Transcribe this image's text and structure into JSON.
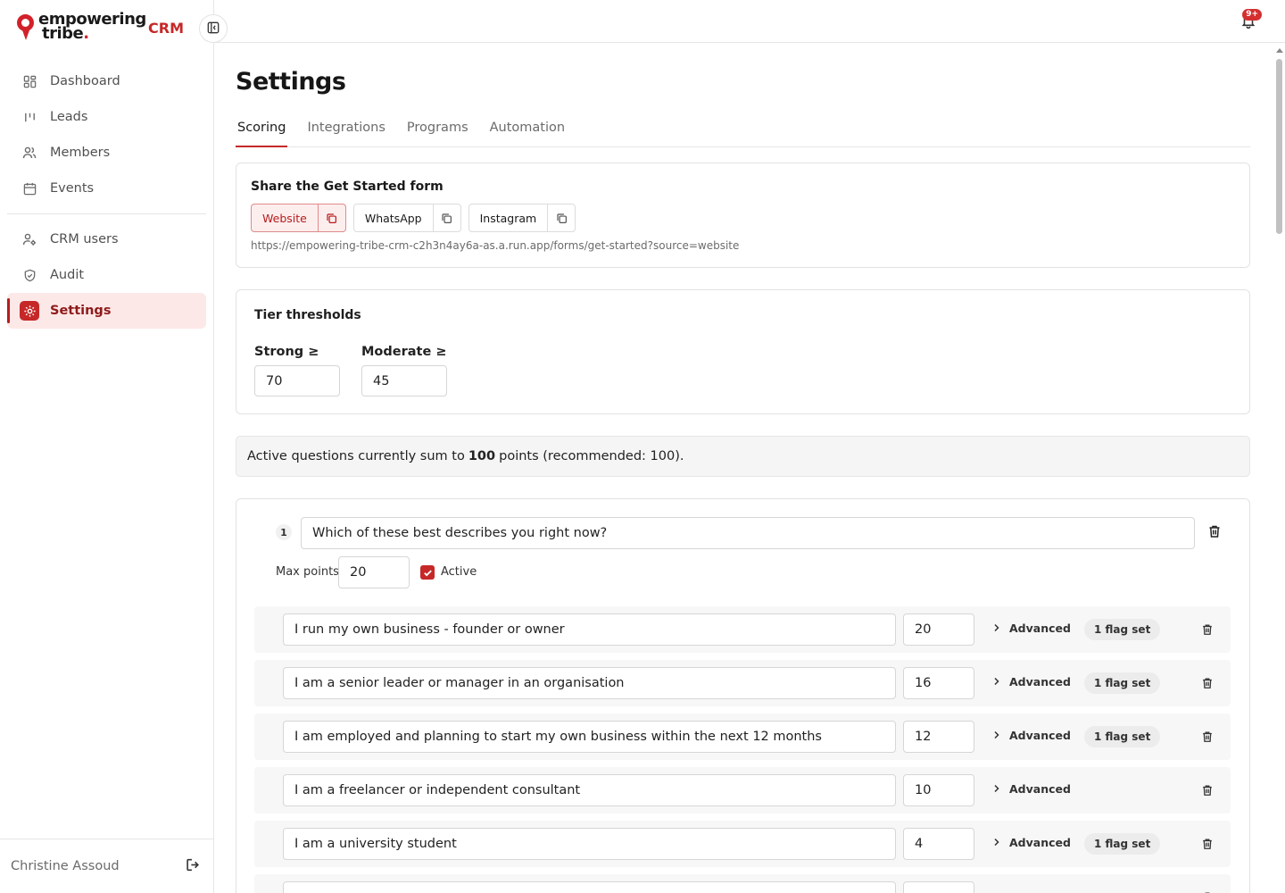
{
  "brand": {
    "line1": "empowering",
    "line2": "tribe",
    "dot": ".",
    "app": "CRM"
  },
  "sidebar": {
    "items": [
      {
        "label": "Dashboard",
        "icon": "dashboard-icon"
      },
      {
        "label": "Leads",
        "icon": "leads-icon"
      },
      {
        "label": "Members",
        "icon": "members-icon"
      },
      {
        "label": "Events",
        "icon": "calendar-icon"
      },
      {
        "label": "CRM users",
        "icon": "crm-users-icon"
      },
      {
        "label": "Audit",
        "icon": "shield-icon"
      },
      {
        "label": "Settings",
        "icon": "gear-icon",
        "active": true
      }
    ],
    "user": "Christine Assoud"
  },
  "topbar": {
    "notification_badge": "9+"
  },
  "page": {
    "title": "Settings"
  },
  "tabs": [
    "Scoring",
    "Integrations",
    "Programs",
    "Automation"
  ],
  "share": {
    "title": "Share the Get Started form",
    "buttons": [
      "Website",
      "WhatsApp",
      "Instagram"
    ],
    "active": "Website",
    "url": "https://empowering-tribe-crm-c2h3n4ay6a-as.a.run.app/forms/get-started?source=website"
  },
  "tier": {
    "title": "Tier thresholds",
    "strong_label": "Strong ≥",
    "strong_value": "70",
    "moderate_label": "Moderate ≥",
    "moderate_value": "45"
  },
  "summary": {
    "prefix": "Active questions currently sum to",
    "total": "100",
    "suffix": "points (recommended: 100)."
  },
  "question": {
    "number": "1",
    "text": "Which of these best describes you right now?",
    "max_points_label": "Max points",
    "max_points": "20",
    "active_label": "Active",
    "active": true,
    "advanced_label": "Advanced",
    "answers": [
      {
        "text": "I run my own business - founder or owner",
        "points": "20",
        "flag": "1 flag set"
      },
      {
        "text": "I am a senior leader or manager in an organisation",
        "points": "16",
        "flag": "1 flag set"
      },
      {
        "text": "I am employed and planning to start my own business within the next 12 months",
        "points": "12",
        "flag": "1 flag set"
      },
      {
        "text": "I am a freelancer or independent consultant",
        "points": "10",
        "flag": ""
      },
      {
        "text": "I am a university student",
        "points": "4",
        "flag": "1 flag set"
      },
      {
        "text": "",
        "points": "",
        "flag": ""
      }
    ]
  },
  "colors": {
    "accent": "#c62828",
    "active_bg": "#fde8e8"
  }
}
